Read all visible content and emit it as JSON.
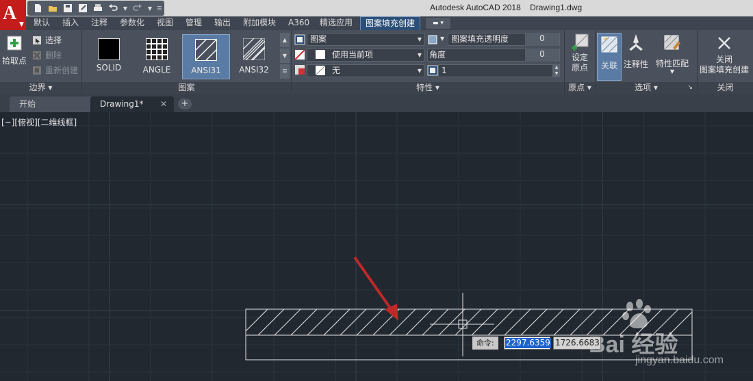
{
  "app": {
    "title": "Autodesk AutoCAD 2018",
    "file": "Drawing1.dwg",
    "logo_letter": "A"
  },
  "ribbon_tabs": [
    "默认",
    "插入",
    "注释",
    "参数化",
    "视图",
    "管理",
    "输出",
    "附加模块",
    "A360",
    "精选应用",
    "图案填充创建"
  ],
  "active_tab": "图案填充创建",
  "boundary_panel": {
    "pick_points": "拾取点",
    "select": "选择",
    "remove": "删除",
    "recreate": "重新创建",
    "label": "边界"
  },
  "pattern_panel": {
    "label": "图案",
    "patterns": [
      {
        "name": "SOLID",
        "selected": false
      },
      {
        "name": "ANGLE",
        "selected": false
      },
      {
        "name": "ANSI31",
        "selected": true
      },
      {
        "name": "ANSI32",
        "selected": false
      }
    ]
  },
  "properties_panel": {
    "label": "特性",
    "hatch_type": "图案",
    "color": "使用当前项",
    "background": "无",
    "transparency_label": "图案填充透明度",
    "transparency_value": "0",
    "angle_label": "角度",
    "angle_value": "0",
    "scale_value": "1"
  },
  "origin_panel": {
    "set_origin_line1": "设定",
    "set_origin_line2": "原点",
    "label": "原点"
  },
  "options_panel": {
    "associative": "关联",
    "annotative": "注释性",
    "match_properties": "特性匹配",
    "label": "选项"
  },
  "close_panel": {
    "close_line1": "关闭",
    "close_line2": "图案填充创建",
    "label": "关闭"
  },
  "doc_tabs": {
    "start": "开始",
    "drawing": "Drawing1*"
  },
  "viewport_label": "[−][俯视][二维线框]",
  "command": {
    "prompt": "命令:",
    "x_value": "2297.6359",
    "y_value": "1726.6683"
  },
  "watermark": {
    "text": "Bai 经验",
    "url": "jingyan.baidu.com"
  },
  "colors": {
    "background": "#212830",
    "ribbon": "#4a515c",
    "active_tab": "#2b4f78",
    "arrow": "#c0282a",
    "logo": "#c41b1b"
  }
}
